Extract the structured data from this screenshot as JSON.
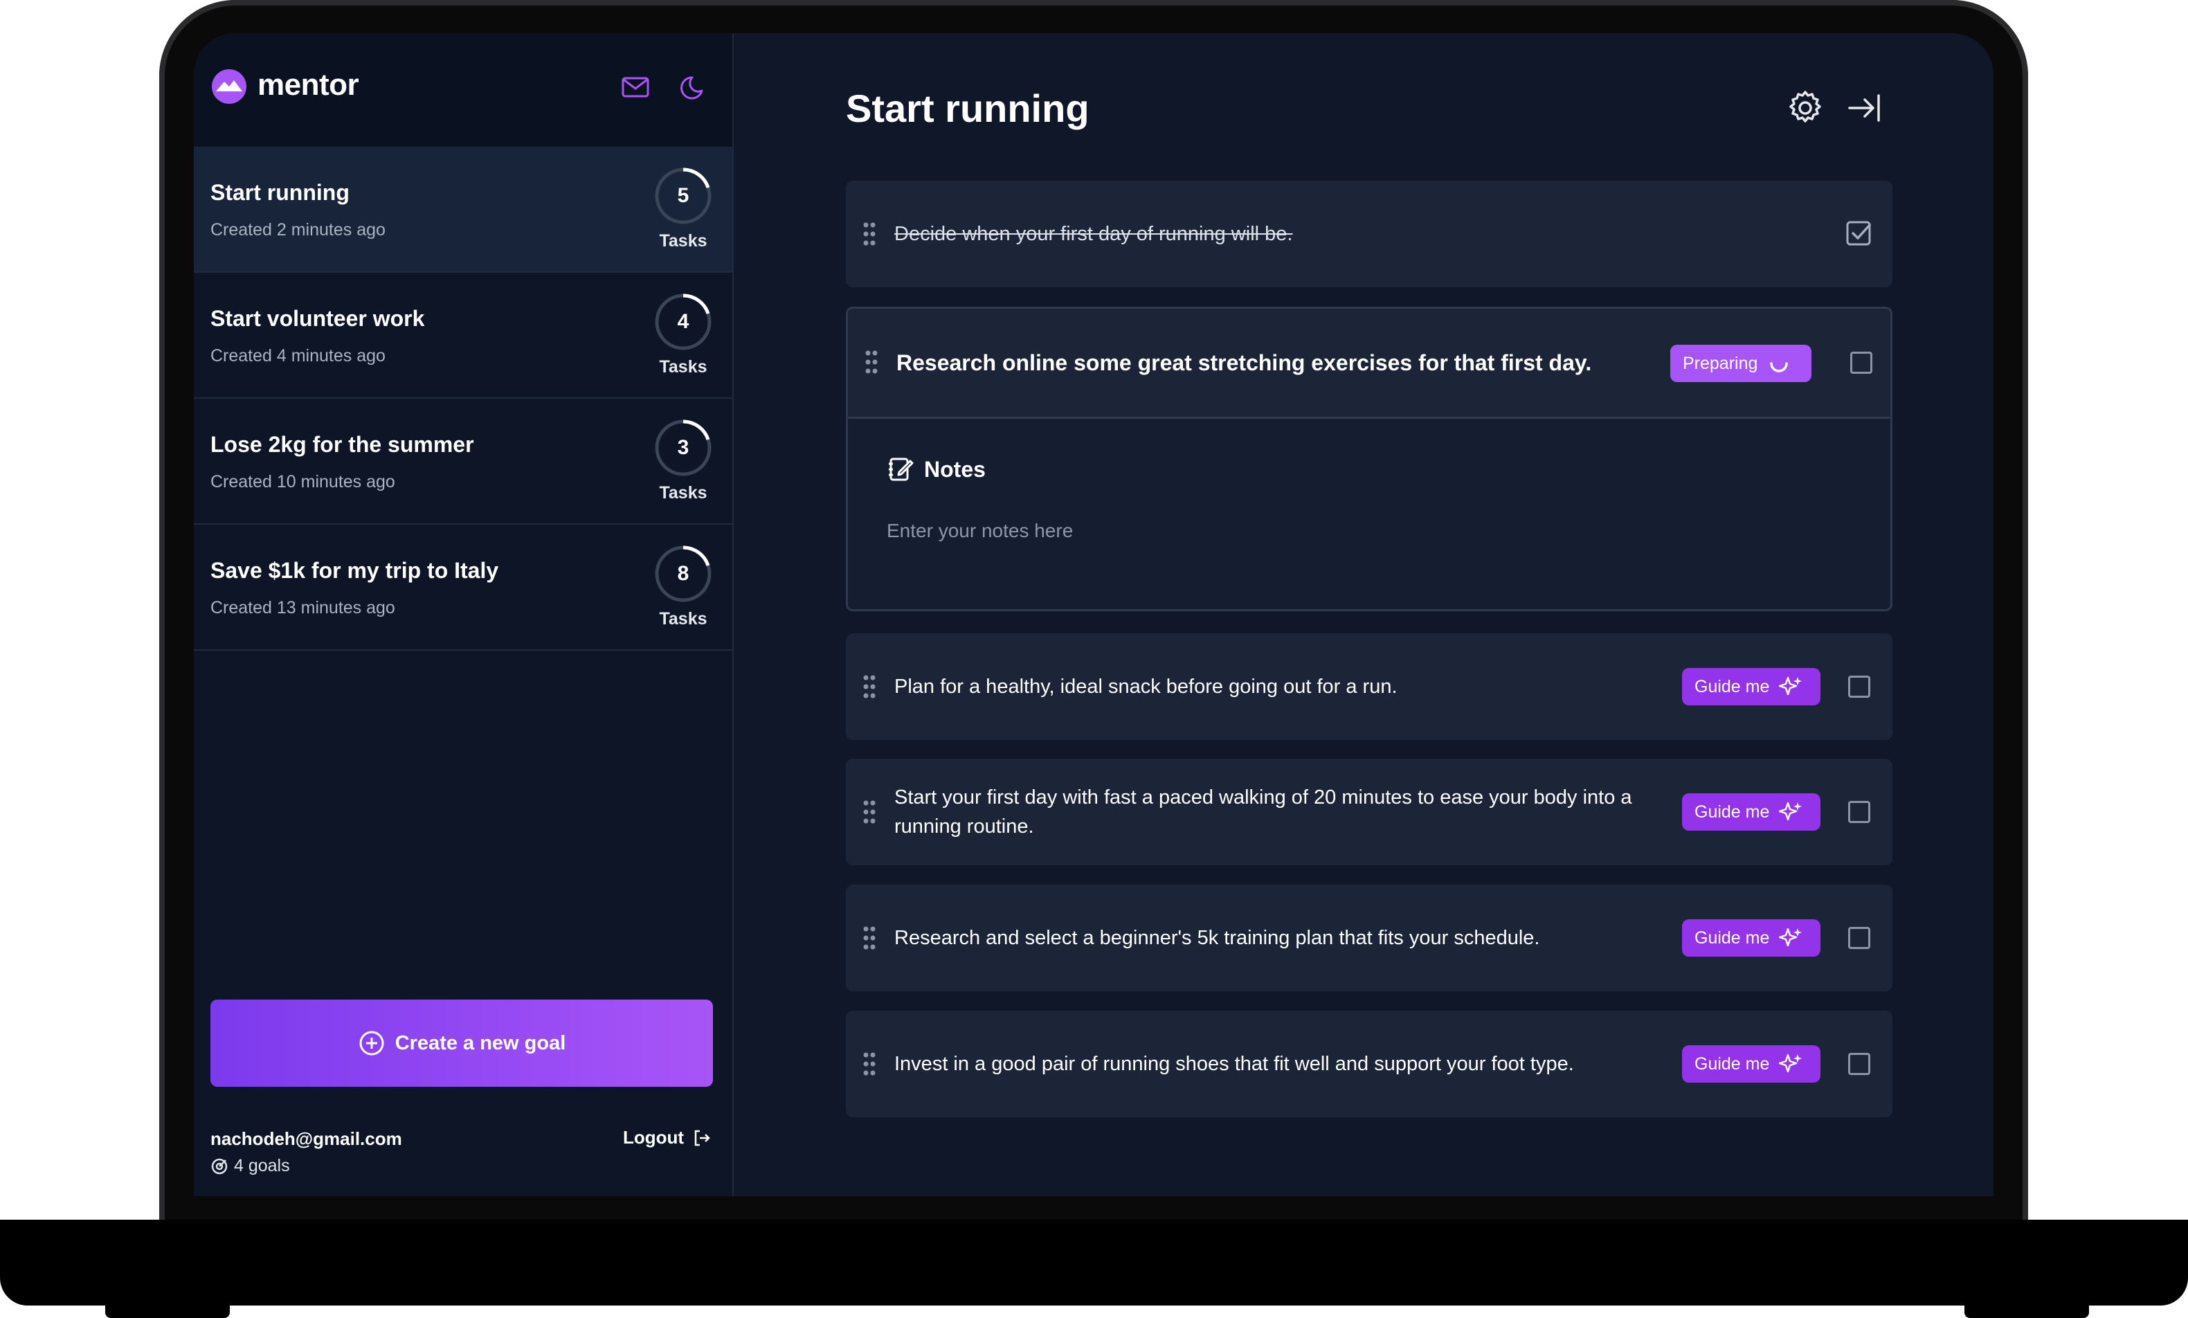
{
  "app": {
    "name": "mentor"
  },
  "colors": {
    "accent": "#a855f7",
    "background": "#0f1729",
    "card": "#1c2537"
  },
  "sidebar": {
    "header_icons": [
      "mail-icon",
      "moon-icon"
    ],
    "goals": [
      {
        "title": "Start running",
        "created": "Created 2 minutes ago",
        "tasks": "5",
        "tasks_label": "Tasks",
        "active": true
      },
      {
        "title": "Start volunteer work",
        "created": "Created 4 minutes ago",
        "tasks": "4",
        "tasks_label": "Tasks"
      },
      {
        "title": "Lose 2kg for the summer",
        "created": "Created 10 minutes ago",
        "tasks": "3",
        "tasks_label": "Tasks"
      },
      {
        "title": "Save $1k for my trip to Italy",
        "created": "Created 13 minutes ago",
        "tasks": "8",
        "tasks_label": "Tasks"
      }
    ],
    "create_button": "Create a new goal",
    "user": {
      "email": "nachodeh@gmail.com",
      "goals_count": "4 goals",
      "logout": "Logout"
    }
  },
  "main": {
    "title": "Start running",
    "header_icons": [
      "settings-icon",
      "collapse-panel-icon"
    ],
    "tasks": [
      {
        "text": "Decide when your first day of running will be.",
        "completed": true
      },
      {
        "text": "Research online some great stretching exercises for that first day.",
        "status": "Preparing",
        "expanded": true
      },
      {
        "text": "Plan for a healthy, ideal snack before going out for a run.",
        "action": "Guide me"
      },
      {
        "text": "Start your first day with fast a paced walking of 20 minutes to ease your body into a running routine.",
        "action": "Guide me"
      },
      {
        "text": "Research and select a beginner's 5k training plan that fits your schedule.",
        "action": "Guide me"
      },
      {
        "text": "Invest in a good pair of running shoes that fit well and support your foot type.",
        "action": "Guide me"
      }
    ],
    "notes": {
      "title": "Notes",
      "placeholder": "Enter your notes here"
    }
  }
}
